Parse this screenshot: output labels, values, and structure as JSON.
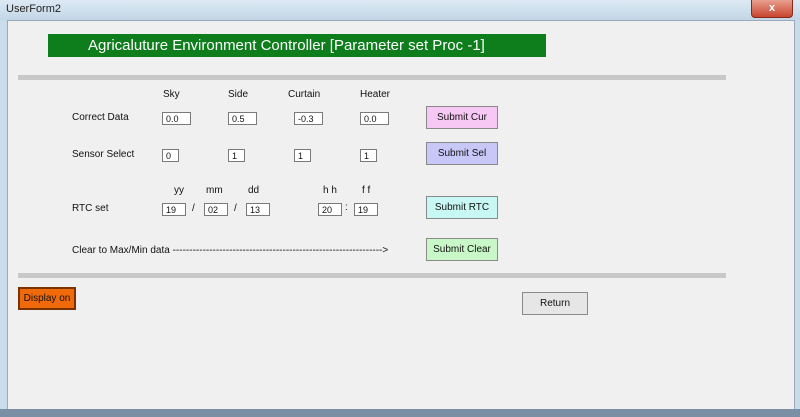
{
  "window": {
    "title": "UserForm2",
    "close_glyph": "x"
  },
  "banner": {
    "text": "Agricaluture Environment Controller [Parameter set Proc -1]"
  },
  "columns": [
    "Sky",
    "Side",
    "Curtain",
    "Heater"
  ],
  "correct": {
    "label": "Correct Data",
    "values": [
      "0.0",
      "0.5",
      "-0.3",
      "0.0"
    ],
    "button": "Submit Cur"
  },
  "sensor": {
    "label": "Sensor Select",
    "values": [
      "0",
      "1",
      "1",
      "1"
    ],
    "button": "Submit Sel"
  },
  "rtc": {
    "label": "RTC set",
    "headers": {
      "yy": "yy",
      "mm": "mm",
      "dd": "dd",
      "hh": "h h",
      "ff": "f f"
    },
    "values": {
      "yy": "19",
      "mm": "02",
      "dd": "13",
      "hh": "20",
      "ff": "19"
    },
    "sep_date": "/",
    "sep_time": ":",
    "button": "Submit RTC"
  },
  "clear": {
    "label": "Clear to  Max/Min data --------------------------------------------------------------->",
    "button": "Submit Clear"
  },
  "display_button": "Display on",
  "return_button": "Return",
  "colors": {
    "banner": "#0e7d1c",
    "submit_cur": "#f8c8f4",
    "submit_sel": "#c8c8f8",
    "submit_rtc": "#c8f8f4",
    "submit_clear": "#c8f8c8",
    "display": "#f06a0a"
  }
}
